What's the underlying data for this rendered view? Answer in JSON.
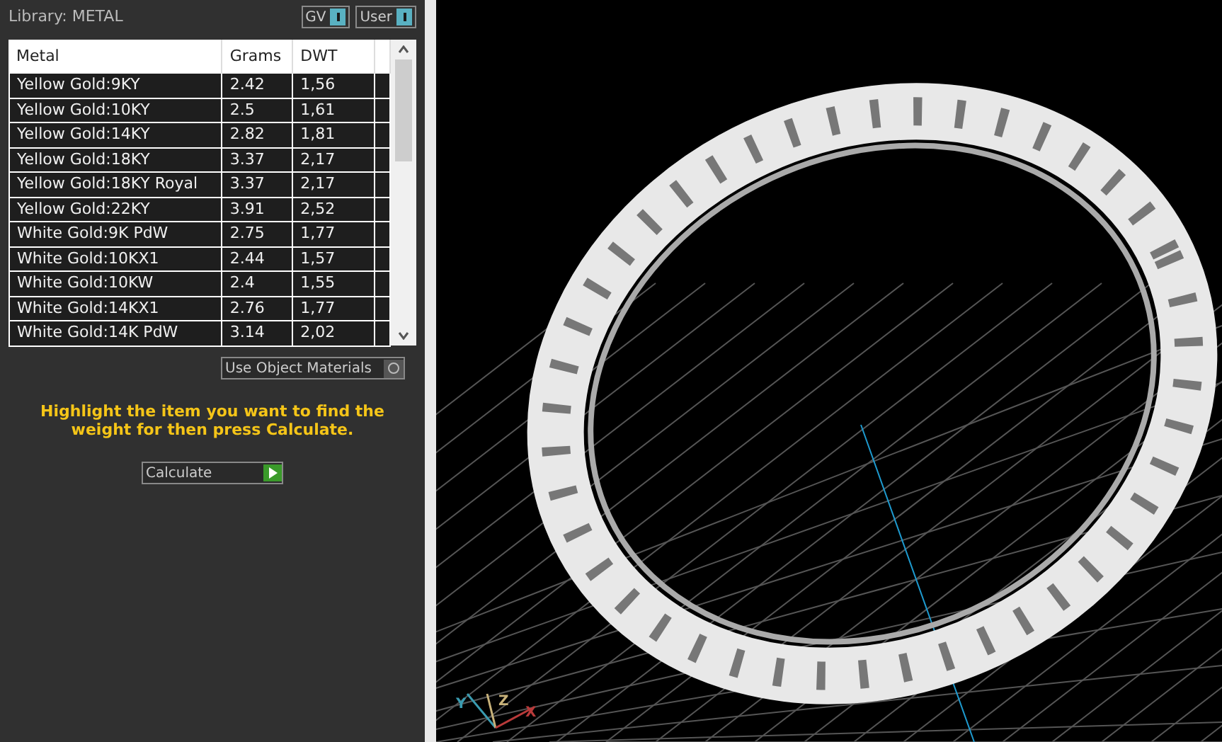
{
  "panel": {
    "title": "Library: METAL",
    "toggles": [
      {
        "label": "GV",
        "on": true
      },
      {
        "label": "User",
        "on": true
      }
    ]
  },
  "table": {
    "columns": [
      "Metal",
      "Grams",
      "DWT"
    ],
    "rows": [
      {
        "cells": [
          "Yellow Gold:9KY",
          "2.42",
          "1,56"
        ]
      },
      {
        "cells": [
          "Yellow Gold:10KY",
          "2.5",
          "1,61"
        ]
      },
      {
        "cells": [
          "Yellow Gold:14KY",
          "2.82",
          "1,81"
        ]
      },
      {
        "cells": [
          "Yellow Gold:18KY",
          "3.37",
          "2,17"
        ]
      },
      {
        "cells": [
          "Yellow Gold:18KY Royal",
          "3.37",
          "2,17"
        ]
      },
      {
        "cells": [
          "Yellow Gold:22KY",
          "3.91",
          "2,52"
        ]
      },
      {
        "cells": [
          "White Gold:9K PdW",
          "2.75",
          "1,77"
        ]
      },
      {
        "cells": [
          "White Gold:10KX1",
          "2.44",
          "1,57"
        ]
      },
      {
        "cells": [
          "White Gold:10KW",
          "2.4",
          "1,55"
        ]
      },
      {
        "cells": [
          "White Gold:14KX1",
          "2.76",
          "1,77"
        ]
      },
      {
        "cells": [
          "White Gold:14K PdW",
          "3.14",
          "2,02"
        ]
      }
    ]
  },
  "use_object_materials": {
    "label": "Use Object Materials",
    "checked": false
  },
  "hint": "Highlight the item you want to find the weight for then press Calculate.",
  "calculate": {
    "label": "Calculate"
  },
  "viewport": {
    "axes": [
      {
        "label": "Y",
        "color": "#3a9bb0"
      },
      {
        "label": "Z",
        "color": "#c8b27a"
      },
      {
        "label": "X",
        "color": "#b83a3a"
      }
    ]
  }
}
